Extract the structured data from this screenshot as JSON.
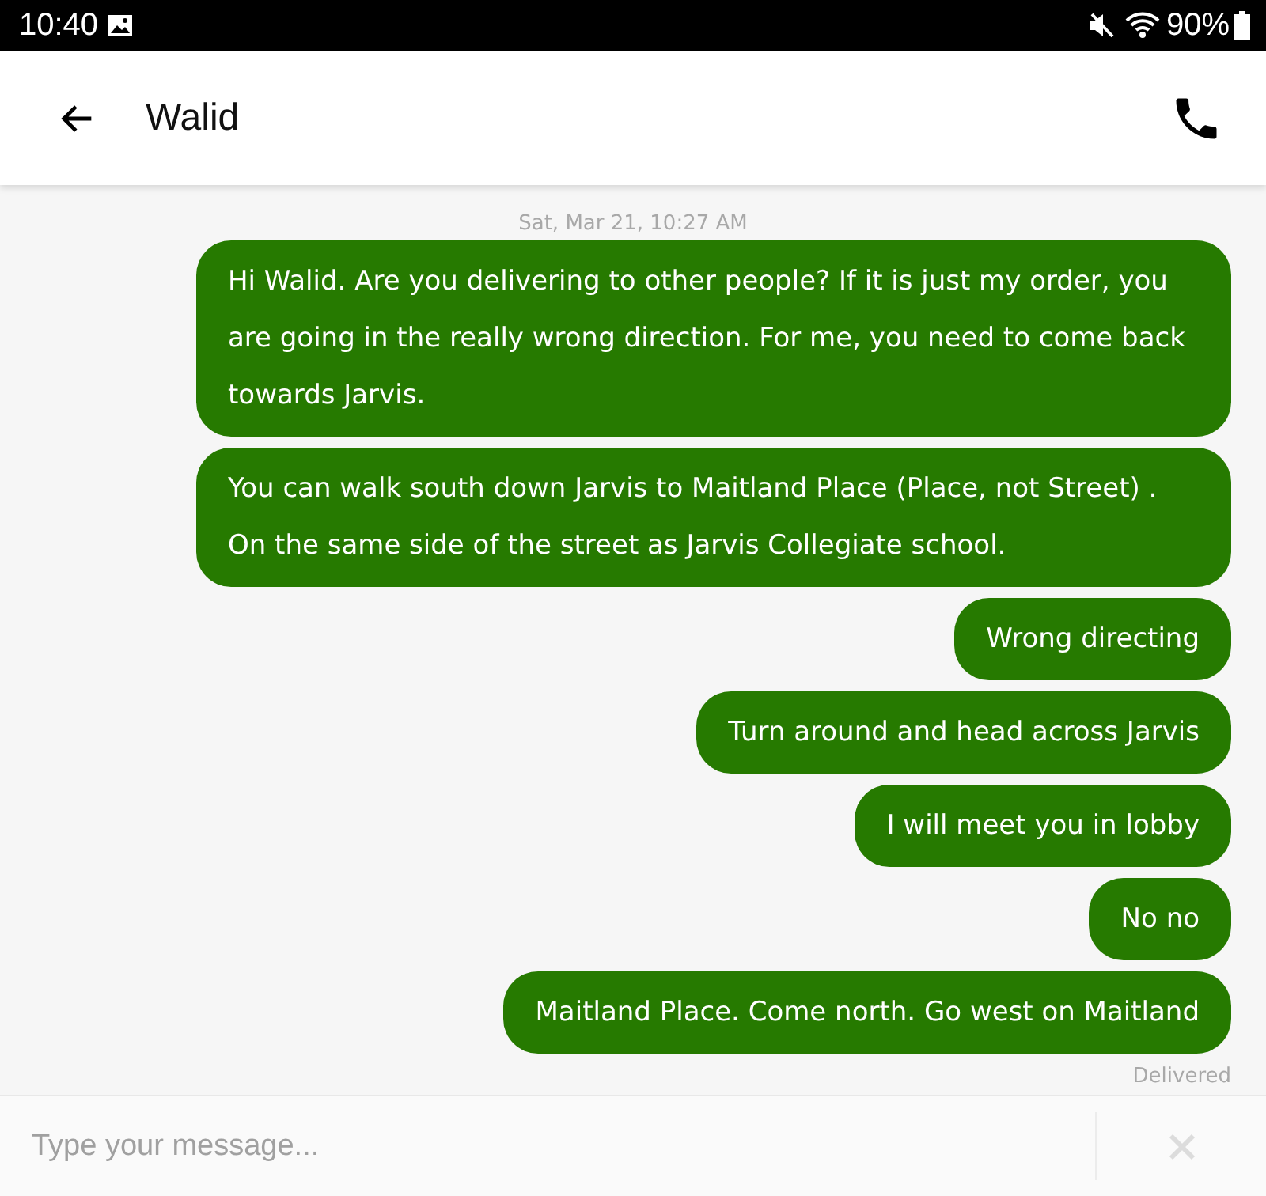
{
  "status_bar": {
    "time": "10:40",
    "battery": "90%"
  },
  "header": {
    "title": "Walid"
  },
  "conversation": {
    "timestamp": "Sat, Mar 21, 10:27 AM",
    "messages": [
      {
        "text": "Hi Walid. Are you delivering to other people? If it is just my order, you are going in the really wrong direction. For me, you need to come back towards Jarvis."
      },
      {
        "text": "You can walk south down Jarvis to Maitland Place (Place, not Street) . On the same side of the street as Jarvis Collegiate school."
      },
      {
        "text": "Wrong directing"
      },
      {
        "text": "Turn around and head across Jarvis"
      },
      {
        "text": "I will meet you in lobby"
      },
      {
        "text": "No no"
      },
      {
        "text": "Maitland Place. Come north. Go west on Maitland"
      }
    ],
    "delivery_status": "Delivered"
  },
  "composer": {
    "placeholder": "Type your message..."
  }
}
